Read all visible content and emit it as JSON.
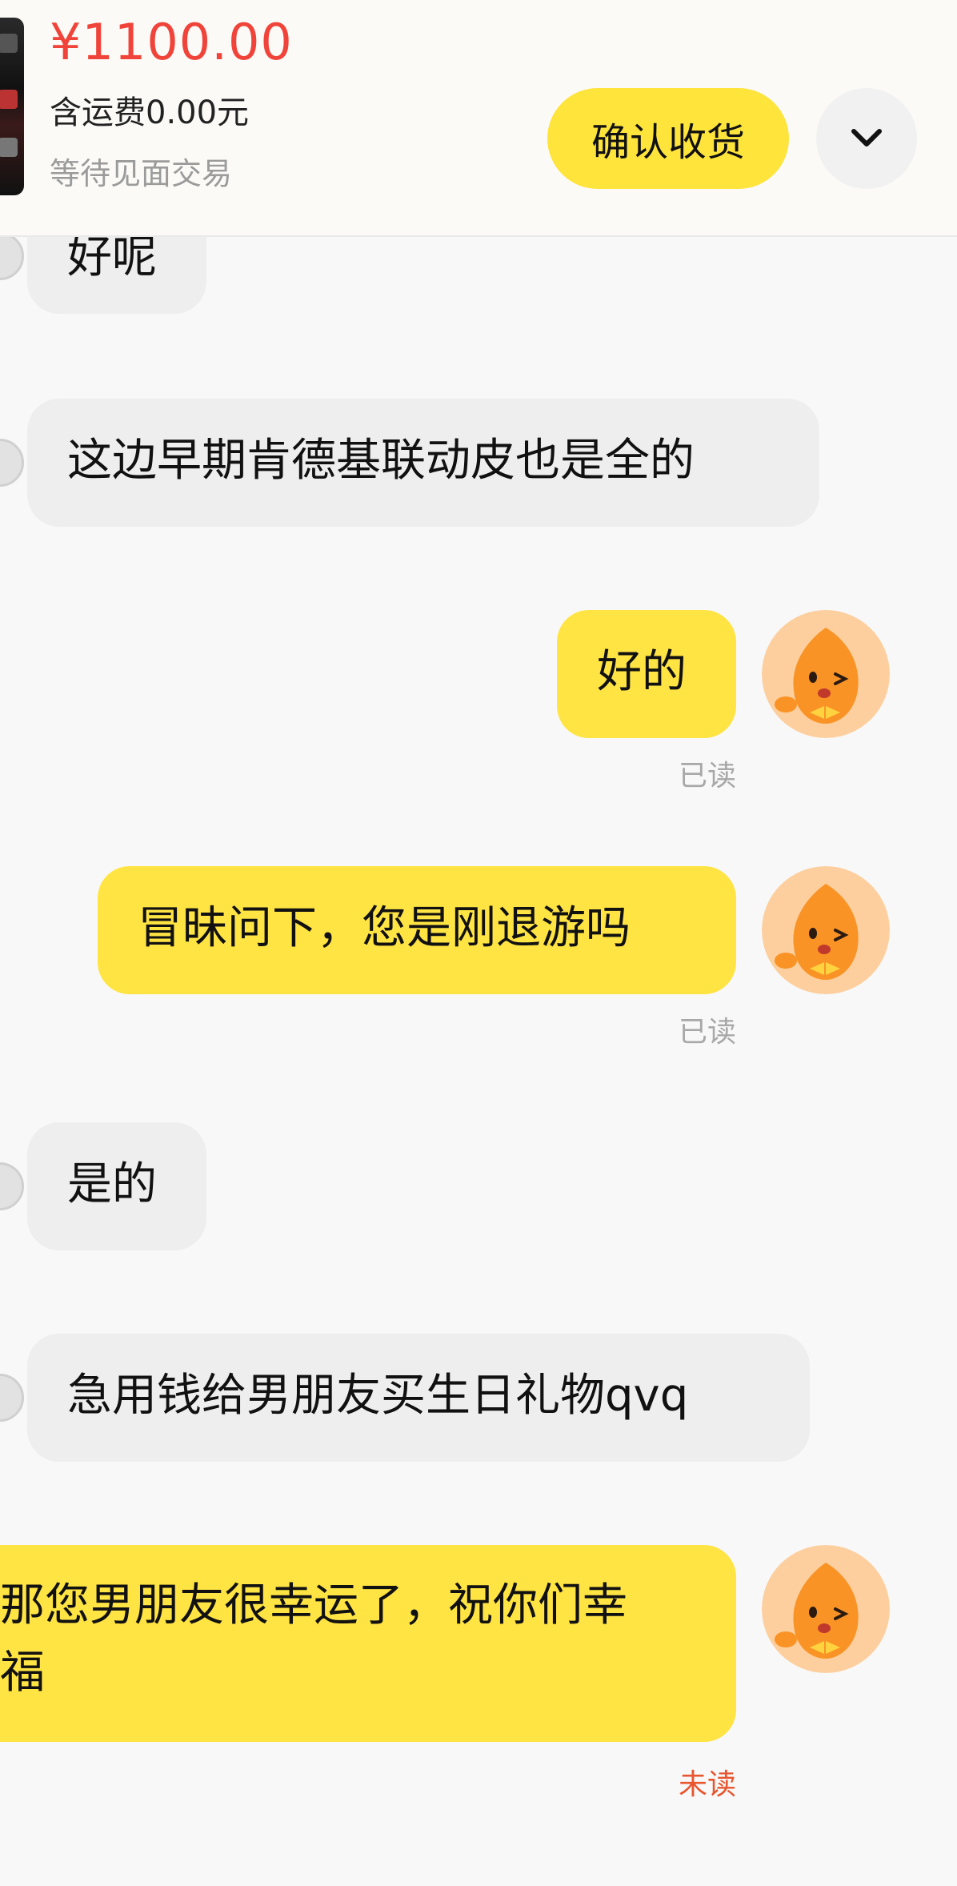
{
  "order": {
    "price": "¥1100.00",
    "shipping": "含运费0.00元",
    "status": "等待见面交易",
    "confirm_button": "确认收货",
    "expand_icon": "chevron-down-icon"
  },
  "messages": [
    {
      "side": "in",
      "text": "好呢"
    },
    {
      "side": "in",
      "text": "这边早期肯德基联动皮也是全的"
    },
    {
      "side": "out",
      "text": "好的",
      "status": "已读"
    },
    {
      "side": "out",
      "text": "冒昧问下，您是刚退游吗",
      "status": "已读"
    },
    {
      "side": "in",
      "text": "是的"
    },
    {
      "side": "in",
      "text": "急用钱给男朋友买生日礼物qvq"
    },
    {
      "side": "out",
      "line1": "那您男朋友很幸运了，祝你们幸",
      "line2": "福",
      "status": "未读"
    }
  ],
  "colors": {
    "price": "#f0443a",
    "accent_yellow": "#ffe43c",
    "incoming_bubble": "#eeeeef",
    "unread": "#e8552f"
  }
}
